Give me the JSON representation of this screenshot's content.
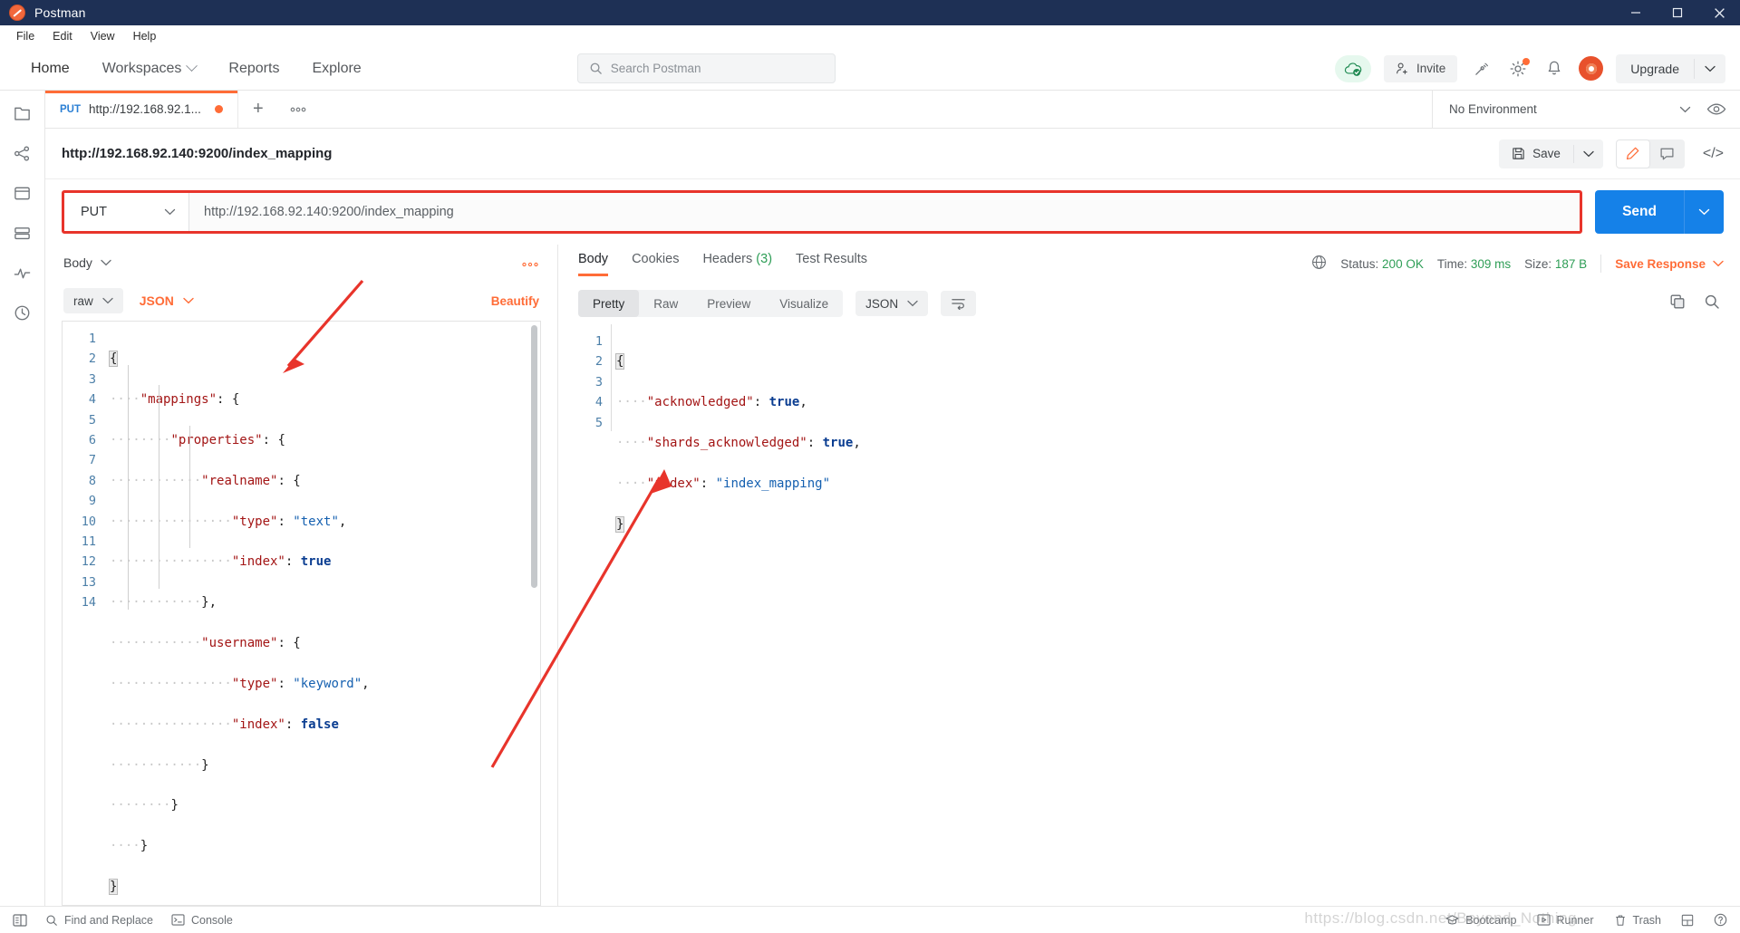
{
  "window": {
    "title": "Postman",
    "logo_icon": "postman-logo-icon",
    "minimize_icon": "minimize-icon",
    "maximize_icon": "maximize-icon",
    "close_icon": "close-icon"
  },
  "menubar": [
    "File",
    "Edit",
    "View",
    "Help"
  ],
  "topnav": {
    "items": [
      {
        "label": "Home",
        "has_caret": false
      },
      {
        "label": "Workspaces",
        "has_caret": true
      },
      {
        "label": "Reports",
        "has_caret": false
      },
      {
        "label": "Explore",
        "has_caret": false
      }
    ],
    "search_placeholder": "Search Postman",
    "search_icon": "search-icon",
    "cloud_sync_icon": "cloud-check-icon",
    "invite_label": "Invite",
    "invite_icon": "user-plus-icon",
    "satellite_icon": "satellite-icon",
    "settings_icon": "gear-icon",
    "notifications_icon": "bell-icon",
    "account_icon": "account-avatar-icon",
    "upgrade_label": "Upgrade",
    "upgrade_caret_icon": "chevron-down-icon"
  },
  "leftrail": {
    "icons": [
      "collections-icon",
      "apis-icon",
      "environments-icon",
      "mock-servers-icon",
      "monitors-icon",
      "history-icon"
    ]
  },
  "tabstrip": {
    "tabs": [
      {
        "method": "PUT",
        "title": "http://192.168.92.1...",
        "unsaved": true,
        "active": true
      }
    ],
    "new_tab_icon": "plus-icon",
    "more_icon": "ellipsis-icon",
    "environment": "No Environment",
    "environment_caret_icon": "chevron-down-icon",
    "eye_icon": "eye-icon"
  },
  "request": {
    "name": "http://192.168.92.140:9200/index_mapping",
    "save_label": "Save",
    "save_icon": "floppy-disk-icon",
    "save_caret_icon": "chevron-down-icon",
    "edit_icon": "pencil-icon",
    "comment_icon": "comment-icon",
    "code_icon": "code-brackets-icon",
    "method": "PUT",
    "method_caret_icon": "chevron-down-icon",
    "url": "http://192.168.92.140:9200/index_mapping",
    "send_label": "Send",
    "send_caret_icon": "chevron-down-icon"
  },
  "request_body": {
    "section_label": "Body",
    "section_caret_icon": "chevron-down-icon",
    "more_icon": "ellipsis-icon",
    "mode": "raw",
    "mode_caret_icon": "chevron-down-icon",
    "format": "JSON",
    "format_caret_icon": "chevron-down-icon",
    "beautify_label": "Beautify",
    "line_count": 14,
    "lines": [
      "{",
      "    \"mappings\": {",
      "        \"properties\": {",
      "            \"realname\": {",
      "                \"type\": \"text\",",
      "                \"index\": true",
      "            },",
      "            \"username\": {",
      "                \"type\": \"keyword\",",
      "                \"index\": false",
      "            }",
      "        }",
      "    }",
      "}"
    ]
  },
  "response": {
    "tabs": [
      {
        "label": "Body",
        "count": "",
        "active": true
      },
      {
        "label": "Cookies",
        "count": "",
        "active": false
      },
      {
        "label": "Headers",
        "count": "(3)",
        "active": false
      },
      {
        "label": "Test Results",
        "count": "",
        "active": false
      }
    ],
    "globe_icon": "globe-icon",
    "status_label": "Status:",
    "status_value": "200 OK",
    "time_label": "Time:",
    "time_value": "309 ms",
    "size_label": "Size:",
    "size_value": "187 B",
    "save_response_label": "Save Response",
    "save_response_caret_icon": "chevron-down-icon",
    "view_tabs": [
      "Pretty",
      "Raw",
      "Preview",
      "Visualize"
    ],
    "view_tab_active": "Pretty",
    "format": "JSON",
    "format_caret_icon": "chevron-down-icon",
    "wrap_icon": "word-wrap-icon",
    "copy_icon": "copy-icon",
    "search_icon": "search-icon",
    "line_count": 5,
    "lines": [
      "{",
      "    \"acknowledged\": true,",
      "    \"shards_acknowledged\": true,",
      "    \"index\": \"index_mapping\"",
      "}"
    ]
  },
  "statusbar": {
    "sidebar_toggle_icon": "sidebar-toggle-icon",
    "find_replace_label": "Find and Replace",
    "find_replace_icon": "search-icon",
    "console_label": "Console",
    "console_icon": "terminal-icon",
    "bootcamp_label": "Bootcamp",
    "bootcamp_icon": "graduation-cap-icon",
    "runner_label": "Runner",
    "runner_icon": "play-box-icon",
    "trash_label": "Trash",
    "trash_icon": "trash-icon",
    "layout_icon": "two-pane-icon",
    "help_icon": "help-circle-icon"
  },
  "watermark": "https://blog.csdn.net/Beyond_Nothing",
  "colors": {
    "accent": "#ff6c37",
    "send": "#1581e8",
    "annotation": "#e8342b",
    "status_ok": "#2f9e57",
    "method_put": "#2b7fd4",
    "titlebar": "#1e3055"
  }
}
